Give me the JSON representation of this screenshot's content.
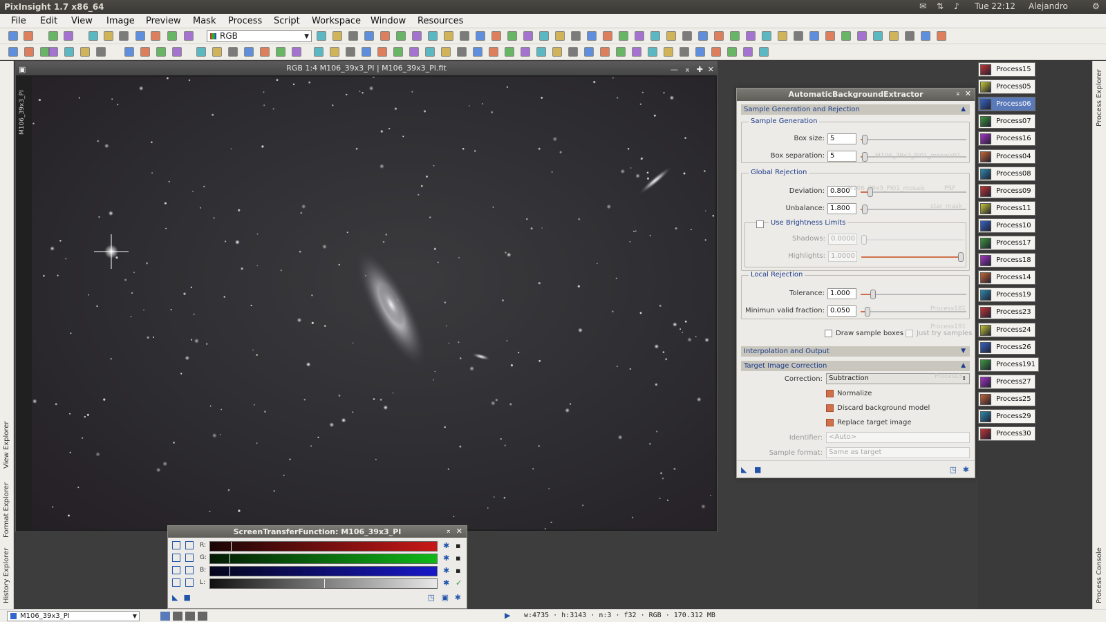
{
  "topbar": {
    "title": "PixInsight 1.7 x86_64",
    "clock": "Tue 22:12",
    "user": "Alejandro"
  },
  "menu": [
    "File",
    "Edit",
    "View",
    "Image",
    "Preview",
    "Mask",
    "Process",
    "Script",
    "Workspace",
    "Window",
    "Resources"
  ],
  "toolbar": {
    "channel_select": "RGB"
  },
  "image_window": {
    "title": "RGB 1:4 M106_39x3_PI | M106_39x3_PI.fit",
    "side_tab": "M106_39x3_PI"
  },
  "left_tabs": [
    "View Explorer",
    "Format Explorer",
    "History Explorer"
  ],
  "right_tabs": [
    "Process Explorer",
    "Process Console"
  ],
  "abe": {
    "title": "AutomaticBackgroundExtractor",
    "sec_sample": "Sample Generation and Rejection",
    "grp_gen": "Sample Generation",
    "box_size_label": "Box size:",
    "box_size": "5",
    "box_sep_label": "Box separation:",
    "box_sep": "5",
    "grp_global": "Global Rejection",
    "deviation_label": "Deviation:",
    "deviation": "0.800",
    "unbalance_label": "Unbalance:",
    "unbalance": "1.800",
    "use_brightness": "Use Brightness Limits",
    "shadows_label": "Shadows:",
    "shadows": "0.0000",
    "highlights_label": "Highlights:",
    "highlights": "1.0000",
    "grp_local": "Local Rejection",
    "tolerance_label": "Tolerance:",
    "tolerance": "1.000",
    "minvalid_label": "Minimun valid fraction:",
    "minvalid": "0.050",
    "draw_boxes": "Draw sample boxes",
    "just_try": "Just try samples",
    "sec_interp": "Interpolation and Output",
    "sec_target": "Target Image Correction",
    "correction_label": "Correction:",
    "correction": "Subtraction",
    "normalize": "Normalize",
    "discard": "Discard background model",
    "replace": "Replace target image",
    "identifier_label": "Identifier:",
    "identifier": "<Auto>",
    "sample_format_label": "Sample format:",
    "sample_format": "Same as target",
    "ghosts": [
      "M106_39x3_PI01_mosaic01",
      "M106_39x3_PI01_mosaic",
      "PSF",
      "star_mask",
      "Process181",
      "Process191",
      "Process3"
    ]
  },
  "stf": {
    "title": "ScreenTransferFunction: M106_39x3_PI",
    "channels": [
      "R:",
      "G:",
      "B:",
      "L:"
    ],
    "colors": [
      "#c81818",
      "#10b818",
      "#1818c8",
      "#e0e0e0"
    ]
  },
  "processes": [
    "Process15",
    "Process05",
    "Process06",
    "Process07",
    "Process16",
    "Process04",
    "Process08",
    "Process09",
    "Process11",
    "Process10",
    "Process17",
    "Process18",
    "Process14",
    "Process19",
    "Process23",
    "Process24",
    "Process26",
    "Process191",
    "Process27",
    "Process25",
    "Process29",
    "Process30"
  ],
  "status": {
    "view": "M106_39x3_PI",
    "info": "w:4735 · h:3143 · n:3 · f32 · RGB · 170.312 MB"
  }
}
